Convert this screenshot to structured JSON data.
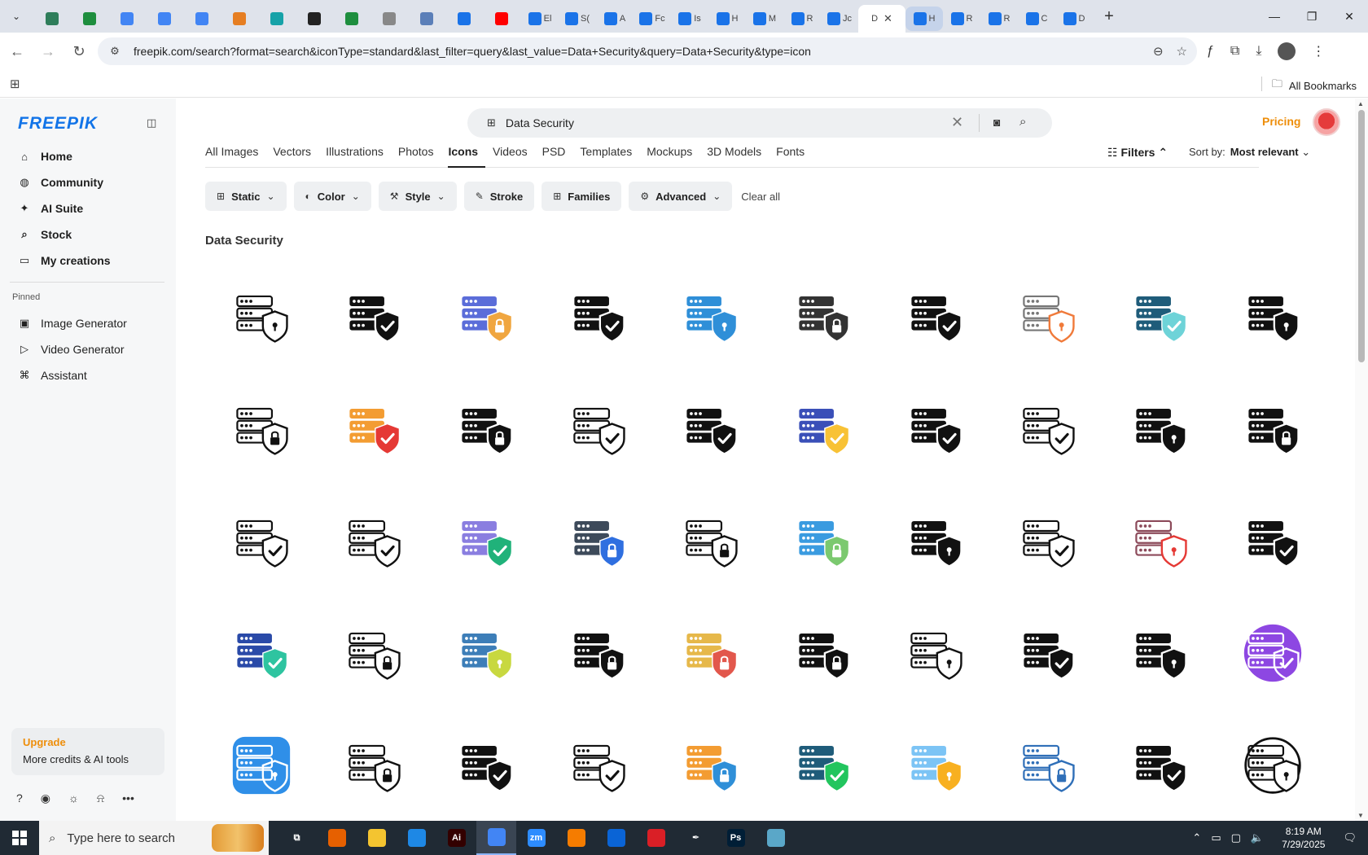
{
  "browser": {
    "tabs": [
      {
        "name": "tab-1",
        "color": "#2e7d5a",
        "label": ""
      },
      {
        "name": "tab-2",
        "color": "#1e8e3e",
        "label": ""
      },
      {
        "name": "tab-3",
        "color": "#4285f4",
        "label": ""
      },
      {
        "name": "tab-4",
        "color": "#4285f4",
        "label": ""
      },
      {
        "name": "tab-5",
        "color": "#4285f4",
        "label": ""
      },
      {
        "name": "tab-6",
        "color": "#e67e22",
        "label": ""
      },
      {
        "name": "tab-7",
        "color": "#16a2a8",
        "label": ""
      },
      {
        "name": "tab-8",
        "color": "#222222",
        "label": ""
      },
      {
        "name": "tab-9",
        "color": "#1e8e3e",
        "label": ""
      },
      {
        "name": "tab-10",
        "color": "#888888",
        "label": ""
      },
      {
        "name": "tab-11",
        "color": "#5b7fb8",
        "label": ""
      },
      {
        "name": "tab-12",
        "color": "#1a73e8",
        "label": ""
      },
      {
        "name": "tab-13",
        "color": "#ff0000",
        "label": ""
      },
      {
        "name": "tab-14",
        "color": "#1a73e8",
        "label": "El"
      },
      {
        "name": "tab-15",
        "color": "#1a73e8",
        "label": "S("
      },
      {
        "name": "tab-16",
        "color": "#1a73e8",
        "label": "A"
      },
      {
        "name": "tab-17",
        "color": "#1a73e8",
        "label": "Fc"
      },
      {
        "name": "tab-18",
        "color": "#1a73e8",
        "label": "Is"
      },
      {
        "name": "tab-19",
        "color": "#1a73e8",
        "label": "H"
      },
      {
        "name": "tab-20",
        "color": "#1a73e8",
        "label": "M"
      },
      {
        "name": "tab-21",
        "color": "#1a73e8",
        "label": "R"
      },
      {
        "name": "tab-22",
        "color": "#1a73e8",
        "label": "Jc"
      }
    ],
    "active_tab": {
      "label": "D",
      "close": "✕"
    },
    "tabs_after": [
      {
        "name": "tab-24",
        "color": "#1a73e8",
        "label": "H",
        "highlight": true
      },
      {
        "name": "tab-25",
        "color": "#1a73e8",
        "label": "R"
      },
      {
        "name": "tab-26",
        "color": "#1a73e8",
        "label": "R"
      },
      {
        "name": "tab-27",
        "color": "#1a73e8",
        "label": "C"
      },
      {
        "name": "tab-28",
        "color": "#1a73e8",
        "label": "D"
      }
    ],
    "new_tab": "+",
    "url": "freepik.com/search?format=search&iconType=standard&last_filter=query&last_value=Data+Security&query=Data+Security&type=icon",
    "all_bookmarks": "All Bookmarks"
  },
  "sidebar": {
    "logo": "FREEPIK",
    "nav": [
      {
        "name": "nav-home",
        "icon": "⌂",
        "label": "Home"
      },
      {
        "name": "nav-community",
        "icon": "◍",
        "label": "Community"
      },
      {
        "name": "nav-ai-suite",
        "icon": "✦",
        "label": "AI Suite"
      },
      {
        "name": "nav-stock",
        "icon": "⌕",
        "label": "Stock"
      },
      {
        "name": "nav-my-creations",
        "icon": "▭",
        "label": "My creations"
      }
    ],
    "pinned_title": "Pinned",
    "pinned": [
      {
        "name": "pinned-image-generator",
        "icon": "▣",
        "label": "Image Generator"
      },
      {
        "name": "pinned-video-generator",
        "icon": "▷",
        "label": "Video Generator"
      },
      {
        "name": "pinned-assistant",
        "icon": "⌘",
        "label": "Assistant"
      }
    ],
    "upgrade": {
      "title": "Upgrade",
      "subtitle": "More credits & AI tools"
    }
  },
  "header": {
    "search_value": "Data Security",
    "pricing": "Pricing"
  },
  "categories": [
    {
      "label": "All Images",
      "active": false
    },
    {
      "label": "Vectors",
      "active": false
    },
    {
      "label": "Illustrations",
      "active": false
    },
    {
      "label": "Photos",
      "active": false
    },
    {
      "label": "Icons",
      "active": true
    },
    {
      "label": "Videos",
      "active": false
    },
    {
      "label": "PSD",
      "active": false
    },
    {
      "label": "Templates",
      "active": false
    },
    {
      "label": "Mockups",
      "active": false
    },
    {
      "label": "3D Models",
      "active": false
    },
    {
      "label": "Fonts",
      "active": false
    }
  ],
  "filters_label": "Filters",
  "sort": {
    "label": "Sort by:",
    "value": "Most relevant"
  },
  "chips": [
    {
      "name": "chip-static",
      "icon": "⊞",
      "label": "Static",
      "dropdown": true
    },
    {
      "name": "chip-color",
      "icon": "◐",
      "label": "Color",
      "dropdown": true
    },
    {
      "name": "chip-style",
      "icon": "⚒",
      "label": "Style",
      "dropdown": true
    },
    {
      "name": "chip-stroke",
      "icon": "✎",
      "label": "Stroke",
      "dropdown": false
    },
    {
      "name": "chip-families",
      "icon": "⊞",
      "label": "Families",
      "dropdown": false
    },
    {
      "name": "chip-advanced",
      "icon": "⚙",
      "label": "Advanced",
      "dropdown": true
    }
  ],
  "clear_all": "Clear all",
  "section_title": "Data Security",
  "icons": [
    {
      "style": "line",
      "shape": "shield",
      "c1": "#111111",
      "c2": "#111111"
    },
    {
      "style": "solid",
      "shape": "check",
      "c1": "#111111",
      "c2": "#111111"
    },
    {
      "style": "color",
      "shape": "lock",
      "c1": "#5b6dd9",
      "c2": "#f0a640"
    },
    {
      "style": "solid",
      "shape": "check",
      "c1": "#111111",
      "c2": "#111111"
    },
    {
      "style": "color",
      "shape": "shield",
      "c1": "#2f8fd8",
      "c2": "#2f8fd8"
    },
    {
      "style": "solid",
      "shape": "lock",
      "c1": "#333333",
      "c2": "#333333"
    },
    {
      "style": "solid",
      "shape": "check",
      "c1": "#111111",
      "c2": "#111111"
    },
    {
      "style": "line",
      "shape": "shield",
      "c1": "#777777",
      "c2": "#f07a3a"
    },
    {
      "style": "color",
      "shape": "check",
      "c1": "#1f5c7a",
      "c2": "#6ed3d8"
    },
    {
      "style": "solid",
      "shape": "shield",
      "c1": "#111111",
      "c2": "#111111"
    },
    {
      "style": "line",
      "shape": "lock",
      "c1": "#111111",
      "c2": "#111111"
    },
    {
      "style": "color",
      "shape": "check",
      "c1": "#f39c32",
      "c2": "#e53935"
    },
    {
      "style": "solid",
      "shape": "lock",
      "c1": "#111111",
      "c2": "#111111"
    },
    {
      "style": "line",
      "shape": "check",
      "c1": "#111111",
      "c2": "#111111"
    },
    {
      "style": "solid",
      "shape": "check",
      "c1": "#111111",
      "c2": "#111111"
    },
    {
      "style": "color",
      "shape": "check",
      "c1": "#3a4fb8",
      "c2": "#f8c236"
    },
    {
      "style": "solid",
      "shape": "check",
      "c1": "#111111",
      "c2": "#111111"
    },
    {
      "style": "line",
      "shape": "check",
      "c1": "#111111",
      "c2": "#111111"
    },
    {
      "style": "solid",
      "shape": "shield",
      "c1": "#111111",
      "c2": "#111111"
    },
    {
      "style": "solid",
      "shape": "lock",
      "c1": "#111111",
      "c2": "#111111"
    },
    {
      "style": "line",
      "shape": "check",
      "c1": "#111111",
      "c2": "#111111"
    },
    {
      "style": "line",
      "shape": "check",
      "c1": "#111111",
      "c2": "#111111"
    },
    {
      "style": "color",
      "shape": "check",
      "c1": "#8a7ee0",
      "c2": "#20b27a"
    },
    {
      "style": "color",
      "shape": "lock",
      "c1": "#3d4a5a",
      "c2": "#2f6fe0"
    },
    {
      "style": "line",
      "shape": "lock",
      "c1": "#111111",
      "c2": "#111111"
    },
    {
      "style": "color",
      "shape": "lock",
      "c1": "#3a9be0",
      "c2": "#7bc96f"
    },
    {
      "style": "solid",
      "shape": "shield",
      "c1": "#111111",
      "c2": "#111111"
    },
    {
      "style": "line",
      "shape": "check",
      "c1": "#111111",
      "c2": "#111111"
    },
    {
      "style": "line",
      "shape": "shield",
      "c1": "#8c4a5a",
      "c2": "#e53935"
    },
    {
      "style": "solid",
      "shape": "check",
      "c1": "#111111",
      "c2": "#111111"
    },
    {
      "style": "color",
      "shape": "check",
      "c1": "#2a4aa8",
      "c2": "#2ec4a0"
    },
    {
      "style": "line",
      "shape": "lock",
      "c1": "#111111",
      "c2": "#111111"
    },
    {
      "style": "color",
      "shape": "shield",
      "c1": "#3d7eb8",
      "c2": "#c8d840"
    },
    {
      "style": "solid",
      "shape": "lock",
      "c1": "#111111",
      "c2": "#111111"
    },
    {
      "style": "color",
      "shape": "lock",
      "c1": "#e6b84a",
      "c2": "#e2574c"
    },
    {
      "style": "solid",
      "shape": "lock",
      "c1": "#111111",
      "c2": "#111111"
    },
    {
      "style": "line",
      "shape": "shield",
      "c1": "#111111",
      "c2": "#111111"
    },
    {
      "style": "solid",
      "shape": "check",
      "c1": "#111111",
      "c2": "#111111"
    },
    {
      "style": "solid",
      "shape": "shield",
      "c1": "#111111",
      "c2": "#111111"
    },
    {
      "style": "badge",
      "shape": "check",
      "c1": "#d22ad8",
      "c2": "#3a6af0"
    },
    {
      "style": "badge-blue",
      "shape": "shield",
      "c1": "#2f8fe8",
      "c2": "#ffffff"
    },
    {
      "style": "line",
      "shape": "lock",
      "c1": "#111111",
      "c2": "#111111"
    },
    {
      "style": "solid",
      "shape": "check",
      "c1": "#111111",
      "c2": "#111111"
    },
    {
      "style": "line",
      "shape": "check",
      "c1": "#111111",
      "c2": "#111111"
    },
    {
      "style": "color",
      "shape": "lock",
      "c1": "#f39c32",
      "c2": "#2f8fd8"
    },
    {
      "style": "color",
      "shape": "check",
      "c1": "#1f5c7a",
      "c2": "#22c55e"
    },
    {
      "style": "color",
      "shape": "shield",
      "c1": "#7cc4f5",
      "c2": "#f8b020"
    },
    {
      "style": "line",
      "shape": "lock",
      "c1": "#2f6fb8",
      "c2": "#2f6fb8"
    },
    {
      "style": "solid",
      "shape": "check",
      "c1": "#111111",
      "c2": "#111111"
    },
    {
      "style": "ring",
      "shape": "shield",
      "c1": "#111111",
      "c2": "#111111"
    }
  ],
  "taskbar": {
    "search_placeholder": "Type here to search",
    "apps": [
      {
        "name": "task-view-app",
        "color": "transparent",
        "text": "⧉"
      },
      {
        "name": "firefox-app",
        "color": "#e66000",
        "text": ""
      },
      {
        "name": "file-explorer-app",
        "color": "#f4c430",
        "text": ""
      },
      {
        "name": "vscode-app",
        "color": "#1e88e5",
        "text": ""
      },
      {
        "name": "illustrator-app",
        "color": "#330000",
        "text": "Ai"
      },
      {
        "name": "chrome-app",
        "color": "#4285f4",
        "text": "",
        "active": true
      },
      {
        "name": "zoom-app",
        "color": "#2d8cff",
        "text": "zm"
      },
      {
        "name": "xampp-app",
        "color": "#f57c00",
        "text": ""
      },
      {
        "name": "outlook-app",
        "color": "#0a64d6",
        "text": ""
      },
      {
        "name": "creative-cloud-app",
        "color": "#da1f26",
        "text": ""
      },
      {
        "name": "pen-tool-app",
        "color": "transparent",
        "text": "✒"
      },
      {
        "name": "photoshop-app",
        "color": "#001e36",
        "text": "Ps"
      },
      {
        "name": "vmware-app",
        "color": "#5aa7c8",
        "text": ""
      }
    ],
    "time": "8:19 AM",
    "date": "7/29/2025"
  }
}
